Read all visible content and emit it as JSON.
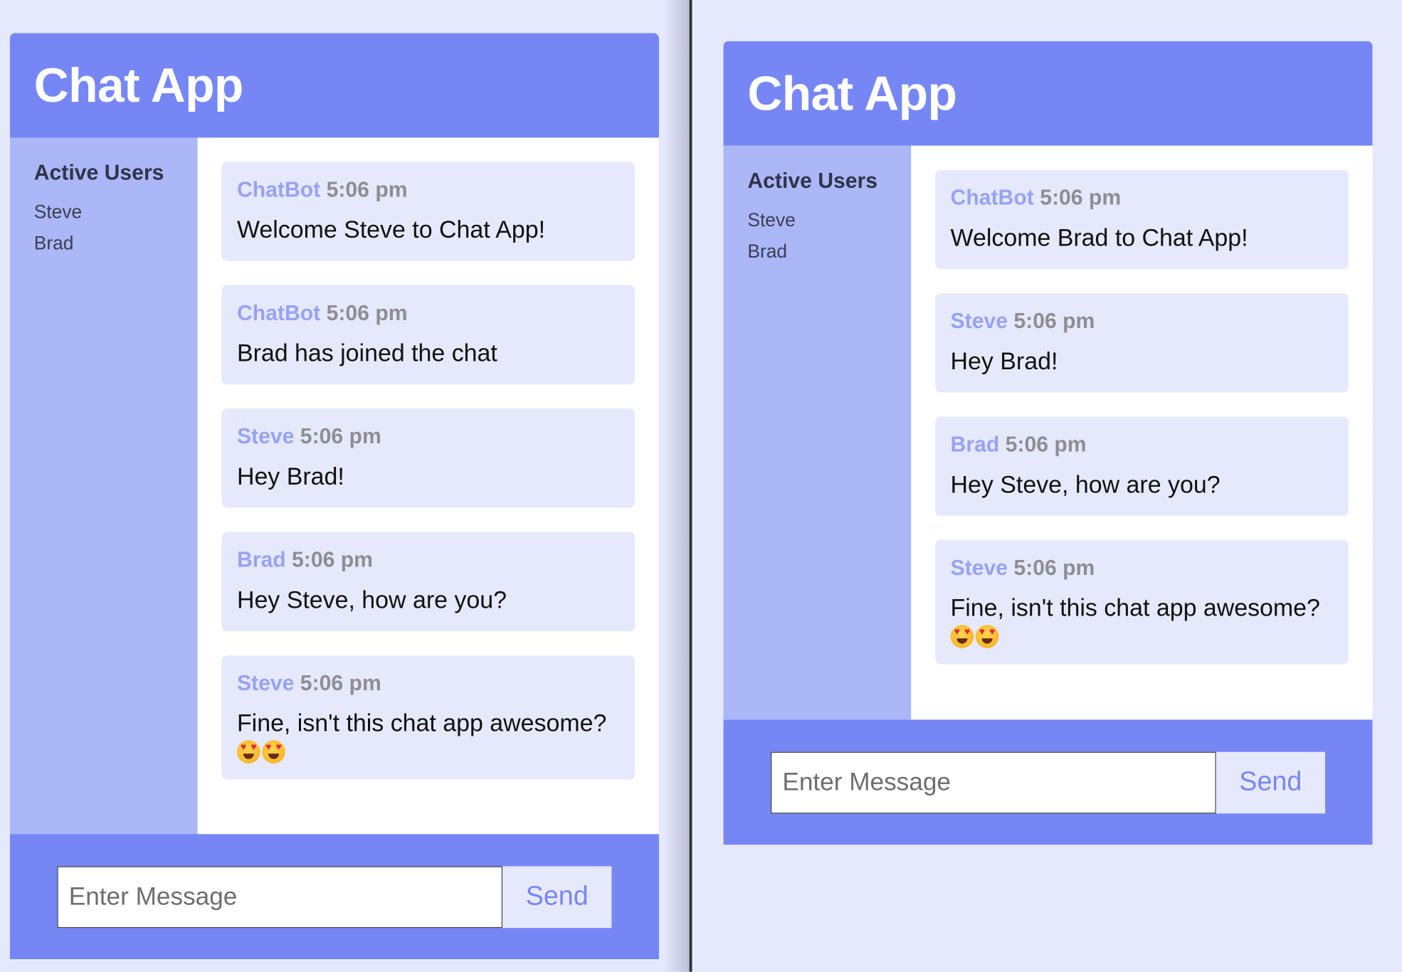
{
  "colors": {
    "accent": "#7687f5",
    "sidebar": "#abb7f7",
    "bubble": "#e6e9fb",
    "sender": "#97a3f3",
    "time": "#8e8e93",
    "divider": "#303030"
  },
  "windows": [
    {
      "title": "Chat App",
      "sidebar": {
        "heading": "Active Users",
        "users": [
          "Steve",
          "Brad"
        ]
      },
      "messages": [
        {
          "sender": "ChatBot",
          "time": "5:06 pm",
          "text": "Welcome Steve to Chat App!",
          "emoji": []
        },
        {
          "sender": "ChatBot",
          "time": "5:06 pm",
          "text": "Brad has joined the chat",
          "emoji": []
        },
        {
          "sender": "Steve",
          "time": "5:06 pm",
          "text": "Hey Brad!",
          "emoji": []
        },
        {
          "sender": "Brad",
          "time": "5:06 pm",
          "text": "Hey Steve, how are you?",
          "emoji": []
        },
        {
          "sender": "Steve",
          "time": "5:06 pm",
          "text": "Fine, isn't this chat app awesome?",
          "emoji": [
            "heart-eyes-emoji-icon",
            "heart-eyes-emoji-icon"
          ]
        }
      ],
      "footer": {
        "input_placeholder": "Enter Message",
        "input_value": "",
        "send_label": "Send"
      }
    },
    {
      "title": "Chat App",
      "sidebar": {
        "heading": "Active Users",
        "users": [
          "Steve",
          "Brad"
        ]
      },
      "messages": [
        {
          "sender": "ChatBot",
          "time": "5:06 pm",
          "text": "Welcome Brad to Chat App!",
          "emoji": []
        },
        {
          "sender": "Steve",
          "time": "5:06 pm",
          "text": "Hey Brad!",
          "emoji": []
        },
        {
          "sender": "Brad",
          "time": "5:06 pm",
          "text": "Hey Steve, how are you?",
          "emoji": []
        },
        {
          "sender": "Steve",
          "time": "5:06 pm",
          "text": "Fine, isn't this chat app awesome?",
          "emoji": [
            "heart-eyes-emoji-icon",
            "heart-eyes-emoji-icon"
          ]
        }
      ],
      "footer": {
        "input_placeholder": "Enter Message",
        "input_value": "",
        "send_label": "Send"
      }
    }
  ]
}
